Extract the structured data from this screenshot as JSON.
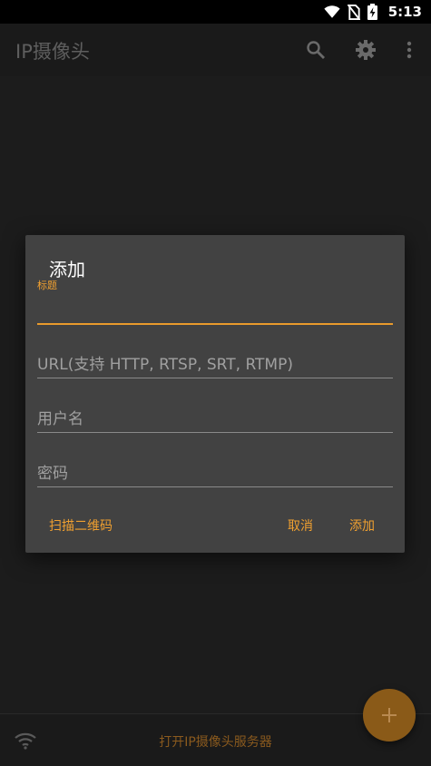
{
  "status_bar": {
    "time": "5:13"
  },
  "app_bar": {
    "title": "IP摄像头",
    "icons": [
      "search-icon",
      "gear-icon",
      "more-vert-icon"
    ]
  },
  "dialog": {
    "title": "添加",
    "fields": {
      "title": {
        "label": "标题",
        "value": ""
      },
      "url": {
        "placeholder": "URL(支持 HTTP, RTSP, SRT, RTMP)"
      },
      "username": {
        "placeholder": "用户名"
      },
      "password": {
        "placeholder": "密码"
      }
    },
    "buttons": {
      "scan_qr": "扫描二维码",
      "cancel": "取消",
      "add": "添加"
    }
  },
  "bottom_bar": {
    "text": "打开IP摄像头服务器",
    "icons": [
      "wifi-icon"
    ]
  },
  "fab": {
    "icon": "plus-icon",
    "symbol": "+"
  },
  "colors": {
    "accent": "#f0a030",
    "dialog_bg": "#424242",
    "background": "#1a1a1a"
  }
}
